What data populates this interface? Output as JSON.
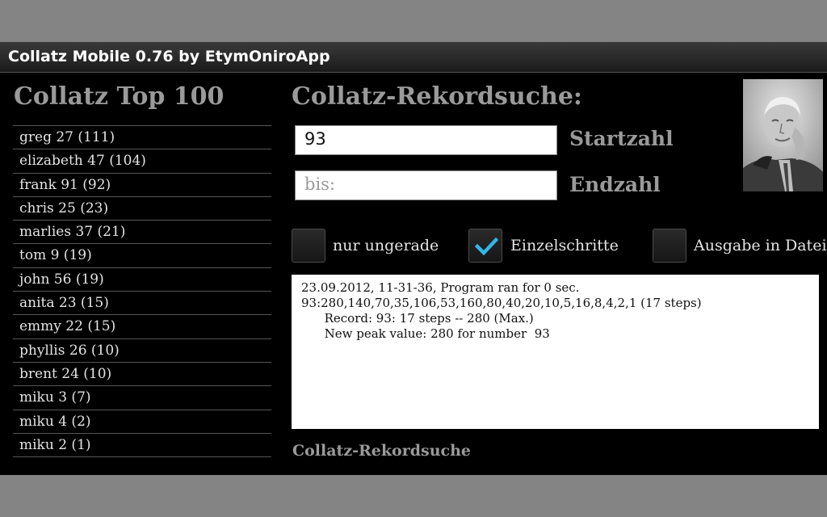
{
  "window": {
    "title": "Collatz Mobile 0.76 by EtymOniroApp"
  },
  "left_panel": {
    "title": "Collatz Top 100",
    "items": [
      "greg 27 (111)",
      "elizabeth 47 (104)",
      "frank 91 (92)",
      "chris 25 (23)",
      "marlies 37 (21)",
      "tom 9 (19)",
      "john 56 (19)",
      "anita 23 (15)",
      "emmy 22 (15)",
      "phyllis 26 (10)",
      "brent 24 (10)",
      "miku 3 (7)",
      "miku 4 (2)",
      "miku 2 (1)"
    ]
  },
  "search": {
    "title": "Collatz-Rekordsuche:",
    "start_value": "93",
    "start_label": "Startzahl",
    "end_placeholder": "bis:",
    "end_label": "Endzahl",
    "portrait_icon": "portrait-photo"
  },
  "options": [
    {
      "label": "nur ungerade",
      "checked": false
    },
    {
      "label": "Einzelschritte",
      "checked": true
    },
    {
      "label": "Ausgabe in Datei",
      "checked": false
    }
  ],
  "output": {
    "lines": [
      "23.09.2012, 11-31-36, Program ran for 0 sec.",
      "93:280,140,70,35,106,53,160,80,40,20,10,5,16,8,4,2,1 (17 steps)",
      "      Record: 93: 17 steps -- 280 (Max.)",
      "      New peak value: 280 for number  93"
    ]
  },
  "footer": {
    "label": "Collatz-Rekordsuche"
  },
  "colors": {
    "accent_check": "#33b5e5",
    "label_gray": "#9a9a9a",
    "background": "#000000"
  }
}
